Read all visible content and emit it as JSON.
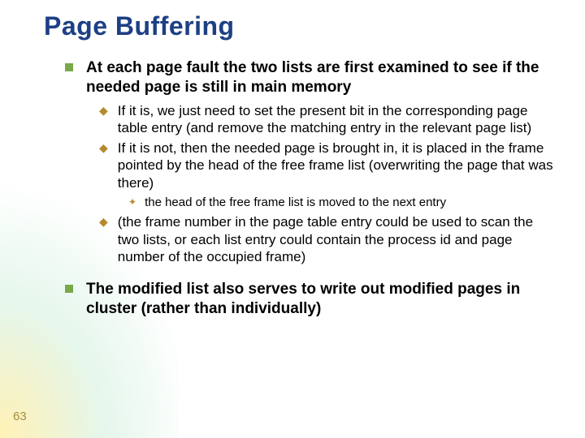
{
  "title": "Page Buffering",
  "page_number": "63",
  "bullets": [
    {
      "level": 1,
      "text": "At each page fault the two lists are first examined to see if the needed page is still in main memory"
    },
    {
      "level": 2,
      "text": "If it is, we just need to set the present bit in the corresponding page table entry (and remove the matching entry in the relevant page list)"
    },
    {
      "level": 2,
      "text": "If it is not, then the needed page is brought in, it is placed in the frame pointed by the head of the free frame list (overwriting the page that was there)"
    },
    {
      "level": 3,
      "text": "the head of the free frame list is moved to the next entry"
    },
    {
      "level": 2,
      "text": "(the frame number in the page table entry could be used to scan the two lists, or each list entry could contain the process id and page number of the occupied frame)"
    },
    {
      "level": 1,
      "text": "The modified list also serves to write out modified pages in cluster (rather than individually)"
    }
  ]
}
